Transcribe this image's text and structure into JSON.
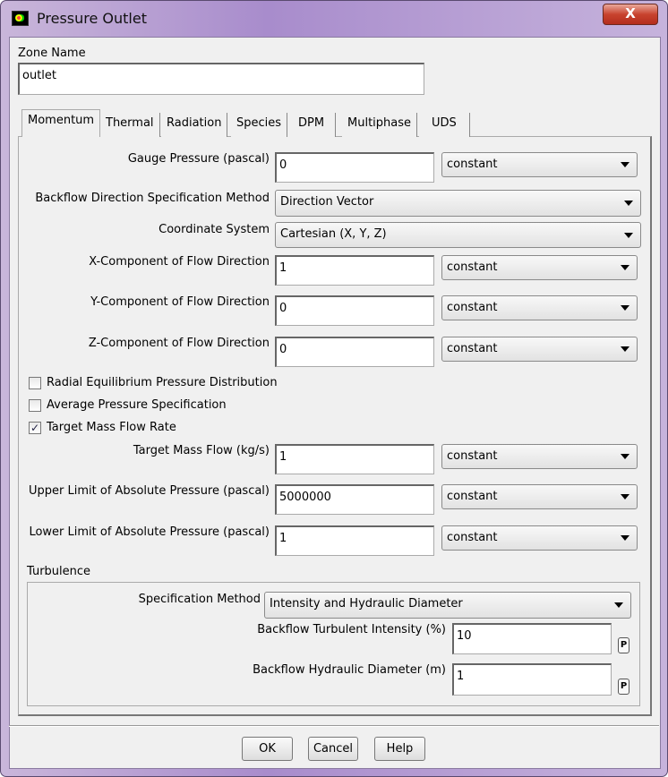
{
  "window": {
    "title": "Pressure Outlet",
    "close_label": "X"
  },
  "zone": {
    "label": "Zone Name",
    "value": "outlet"
  },
  "tabs": [
    "Momentum",
    "Thermal",
    "Radiation",
    "Species",
    "DPM",
    "Multiphase",
    "UDS"
  ],
  "momentum": {
    "gauge": {
      "label": "Gauge Pressure (pascal)",
      "value": "0",
      "method": "constant"
    },
    "backflow_dir": {
      "label": "Backflow Direction Specification Method",
      "value": "Direction Vector"
    },
    "coord": {
      "label": "Coordinate System",
      "value": "Cartesian (X, Y, Z)"
    },
    "x": {
      "label": "X-Component of Flow Direction",
      "value": "1",
      "method": "constant"
    },
    "y": {
      "label": "Y-Component of Flow Direction",
      "value": "0",
      "method": "constant"
    },
    "z": {
      "label": "Z-Component of Flow Direction",
      "value": "0",
      "method": "constant"
    },
    "checks": [
      {
        "label": "Radial Equilibrium Pressure Distribution",
        "checked": false
      },
      {
        "label": "Average Pressure Specification",
        "checked": false
      },
      {
        "label": "Target Mass Flow Rate",
        "checked": true
      }
    ],
    "tmf": {
      "label": "Target Mass Flow (kg/s)",
      "value": "1",
      "method": "constant"
    },
    "upper": {
      "label": "Upper Limit of Absolute Pressure (pascal)",
      "value": "5000000",
      "method": "constant"
    },
    "lower": {
      "label": "Lower Limit of Absolute Pressure (pascal)",
      "value": "1",
      "method": "constant"
    }
  },
  "turbulence": {
    "title": "Turbulence",
    "spec": {
      "label": "Specification Method",
      "value": "Intensity and Hydraulic Diameter"
    },
    "intensity": {
      "label": "Backflow Turbulent Intensity (%)",
      "value": "10",
      "p": "P"
    },
    "diameter": {
      "label": "Backflow Hydraulic Diameter (m)",
      "value": "1",
      "p": "P"
    }
  },
  "buttons": {
    "ok": "OK",
    "cancel": "Cancel",
    "help": "Help"
  }
}
